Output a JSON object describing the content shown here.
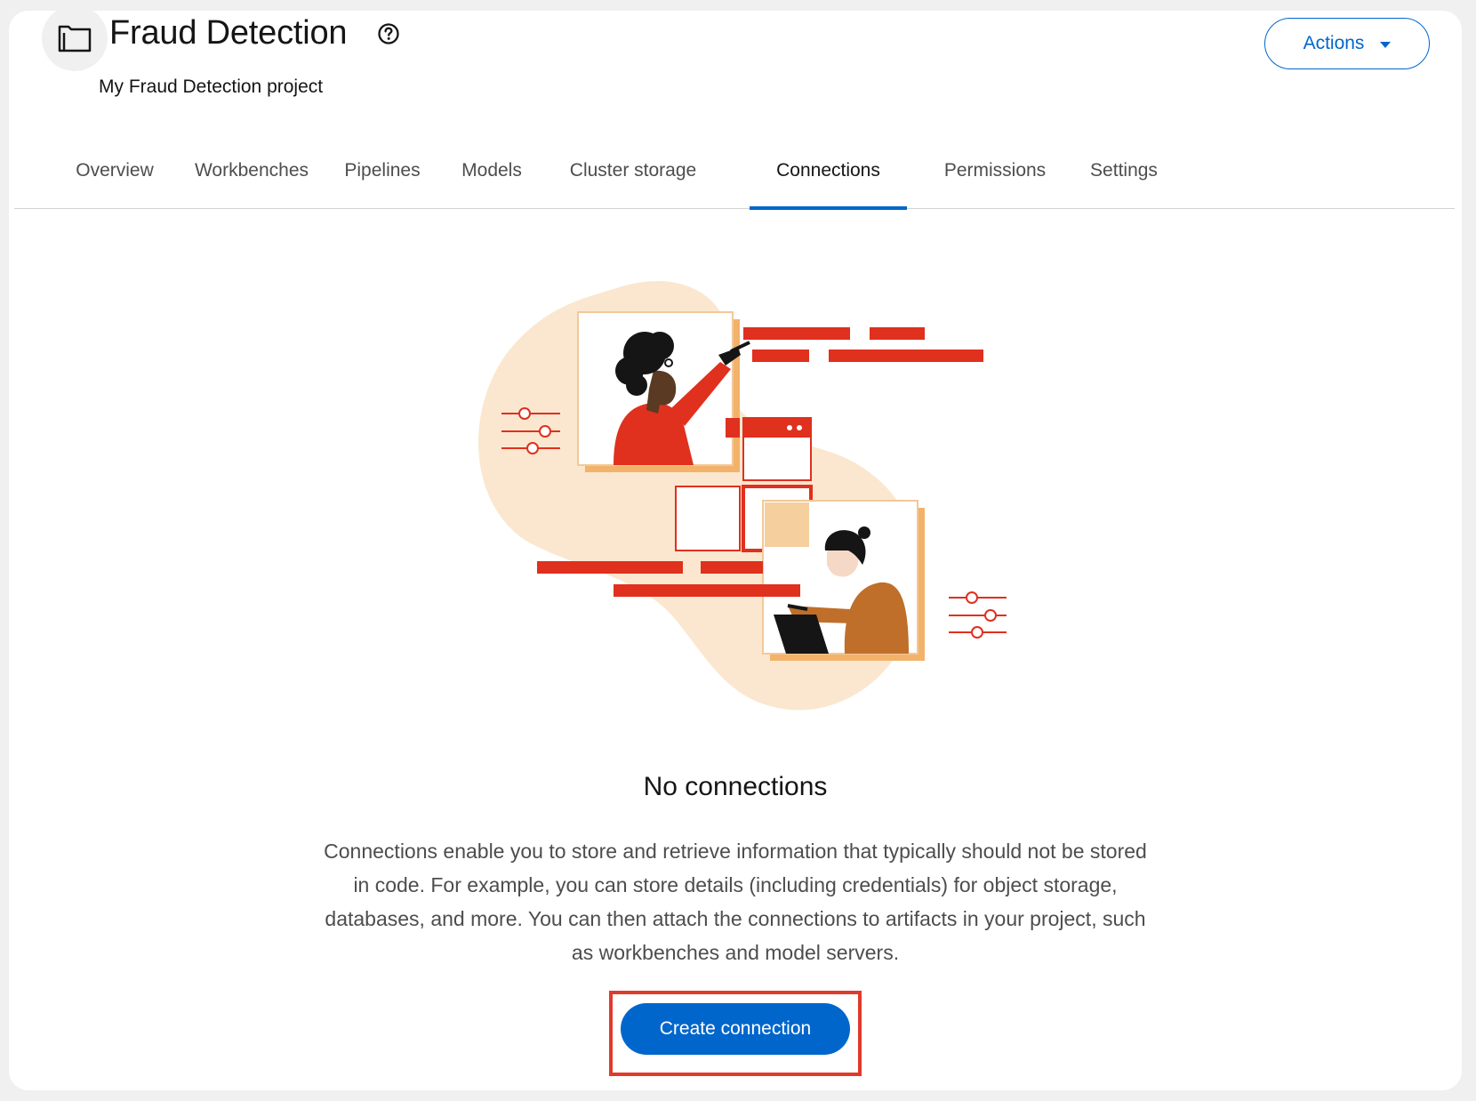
{
  "header": {
    "title": "Fraud Detection",
    "subtitle": "My Fraud Detection project",
    "project_icon": "project-folder-icon",
    "help_icon": "help-icon",
    "actions_label": "Actions"
  },
  "tabs": [
    {
      "label": "Overview",
      "active": false
    },
    {
      "label": "Workbenches",
      "active": false
    },
    {
      "label": "Pipelines",
      "active": false
    },
    {
      "label": "Models",
      "active": false
    },
    {
      "label": "Cluster storage",
      "active": false
    },
    {
      "label": "Connections",
      "active": true
    },
    {
      "label": "Permissions",
      "active": false
    },
    {
      "label": "Settings",
      "active": false
    }
  ],
  "empty_state": {
    "title": "No connections",
    "body": "Connections enable you to store and retrieve information that typically should not be stored in code. For example, you can store details (including credentials) for object storage, databases, and more. You can then attach the connections to artifacts in your project, such as workbenches and model servers.",
    "button_label": "Create connection"
  },
  "colors": {
    "accent": "#0066cc",
    "illustration_red": "#e0301e",
    "illustration_peach": "#fbe7cf",
    "highlight": "#e03a2b"
  }
}
